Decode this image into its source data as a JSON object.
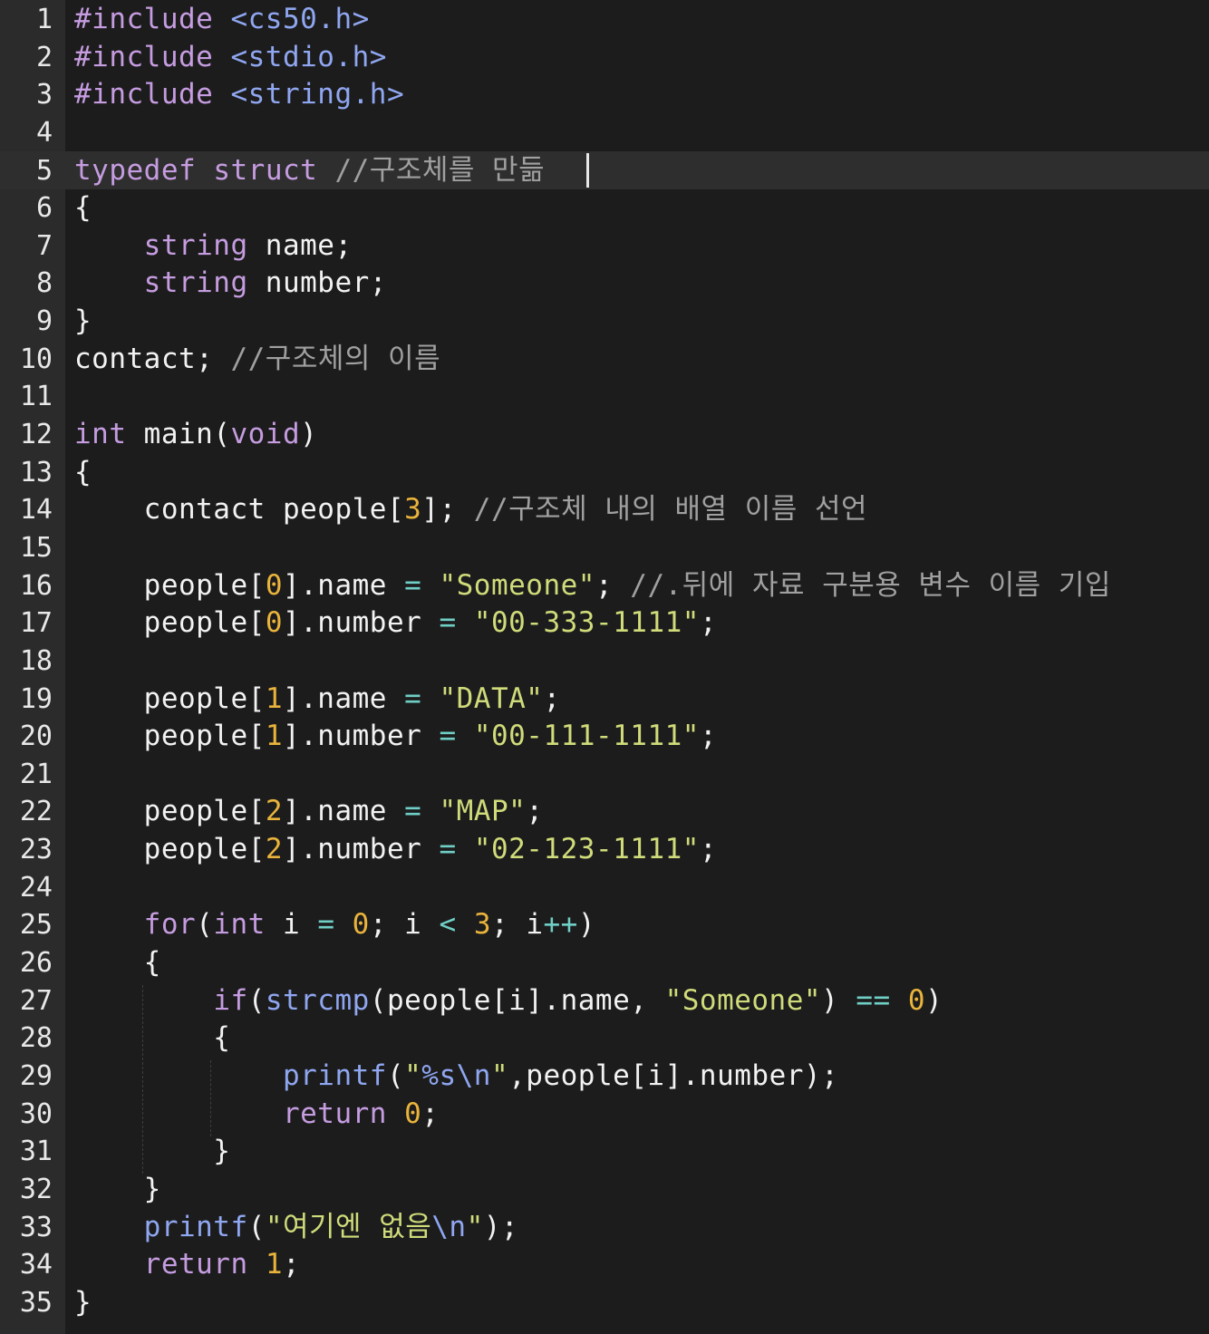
{
  "editor": {
    "active_line": 5,
    "lines": [
      {
        "n": "1",
        "tokens": [
          [
            "pre",
            "#include"
          ],
          [
            "id",
            " "
          ],
          [
            "hdr",
            "<cs50.h>"
          ]
        ]
      },
      {
        "n": "2",
        "tokens": [
          [
            "pre",
            "#include"
          ],
          [
            "id",
            " "
          ],
          [
            "hdr",
            "<stdio.h>"
          ]
        ]
      },
      {
        "n": "3",
        "tokens": [
          [
            "pre",
            "#include"
          ],
          [
            "id",
            " "
          ],
          [
            "hdr",
            "<string.h>"
          ]
        ]
      },
      {
        "n": "4",
        "tokens": []
      },
      {
        "n": "5",
        "tokens": [
          [
            "kw",
            "typedef"
          ],
          [
            "id",
            " "
          ],
          [
            "kw",
            "struct"
          ],
          [
            "id",
            " "
          ],
          [
            "cmt",
            "//구조체를 만듦"
          ]
        ]
      },
      {
        "n": "6",
        "tokens": [
          [
            "id",
            "{"
          ]
        ]
      },
      {
        "n": "7",
        "tokens": [
          [
            "id",
            "    "
          ],
          [
            "kw",
            "string"
          ],
          [
            "id",
            " name;"
          ]
        ]
      },
      {
        "n": "8",
        "tokens": [
          [
            "id",
            "    "
          ],
          [
            "kw",
            "string"
          ],
          [
            "id",
            " number;"
          ]
        ]
      },
      {
        "n": "9",
        "tokens": [
          [
            "id",
            "}"
          ]
        ]
      },
      {
        "n": "10",
        "tokens": [
          [
            "id",
            "contact; "
          ],
          [
            "cmt",
            "//구조체의 이름"
          ]
        ]
      },
      {
        "n": "11",
        "tokens": []
      },
      {
        "n": "12",
        "tokens": [
          [
            "kw",
            "int"
          ],
          [
            "id",
            " main("
          ],
          [
            "kw",
            "void"
          ],
          [
            "id",
            ")"
          ]
        ]
      },
      {
        "n": "13",
        "tokens": [
          [
            "id",
            "{"
          ]
        ]
      },
      {
        "n": "14",
        "tokens": [
          [
            "id",
            "    contact people["
          ],
          [
            "num",
            "3"
          ],
          [
            "id",
            "]; "
          ],
          [
            "cmt",
            "//구조체 내의 배열 이름 선언"
          ]
        ]
      },
      {
        "n": "15",
        "tokens": []
      },
      {
        "n": "16",
        "tokens": [
          [
            "id",
            "    people["
          ],
          [
            "num",
            "0"
          ],
          [
            "id",
            "].name "
          ],
          [
            "op",
            "="
          ],
          [
            "id",
            " "
          ],
          [
            "str",
            "\"Someone\""
          ],
          [
            "id",
            "; "
          ],
          [
            "cmt",
            "//.뒤에 자료 구분용 변수 이름 기입"
          ]
        ]
      },
      {
        "n": "17",
        "tokens": [
          [
            "id",
            "    people["
          ],
          [
            "num",
            "0"
          ],
          [
            "id",
            "].number "
          ],
          [
            "op",
            "="
          ],
          [
            "id",
            " "
          ],
          [
            "str",
            "\"00-333-1111\""
          ],
          [
            "id",
            ";"
          ]
        ]
      },
      {
        "n": "18",
        "tokens": []
      },
      {
        "n": "19",
        "tokens": [
          [
            "id",
            "    people["
          ],
          [
            "num",
            "1"
          ],
          [
            "id",
            "].name "
          ],
          [
            "op",
            "="
          ],
          [
            "id",
            " "
          ],
          [
            "str",
            "\"DATA\""
          ],
          [
            "id",
            ";"
          ]
        ]
      },
      {
        "n": "20",
        "tokens": [
          [
            "id",
            "    people["
          ],
          [
            "num",
            "1"
          ],
          [
            "id",
            "].number "
          ],
          [
            "op",
            "="
          ],
          [
            "id",
            " "
          ],
          [
            "str",
            "\"00-111-1111\""
          ],
          [
            "id",
            ";"
          ]
        ]
      },
      {
        "n": "21",
        "tokens": []
      },
      {
        "n": "22",
        "tokens": [
          [
            "id",
            "    people["
          ],
          [
            "num",
            "2"
          ],
          [
            "id",
            "].name "
          ],
          [
            "op",
            "="
          ],
          [
            "id",
            " "
          ],
          [
            "str",
            "\"MAP\""
          ],
          [
            "id",
            ";"
          ]
        ]
      },
      {
        "n": "23",
        "tokens": [
          [
            "id",
            "    people["
          ],
          [
            "num",
            "2"
          ],
          [
            "id",
            "].number "
          ],
          [
            "op",
            "="
          ],
          [
            "id",
            " "
          ],
          [
            "str",
            "\"02-123-1111\""
          ],
          [
            "id",
            ";"
          ]
        ]
      },
      {
        "n": "24",
        "tokens": []
      },
      {
        "n": "25",
        "tokens": [
          [
            "id",
            "    "
          ],
          [
            "kw",
            "for"
          ],
          [
            "id",
            "("
          ],
          [
            "kw",
            "int"
          ],
          [
            "id",
            " i "
          ],
          [
            "op",
            "="
          ],
          [
            "id",
            " "
          ],
          [
            "num",
            "0"
          ],
          [
            "id",
            "; i "
          ],
          [
            "op",
            "<"
          ],
          [
            "id",
            " "
          ],
          [
            "num",
            "3"
          ],
          [
            "id",
            "; i"
          ],
          [
            "op",
            "++"
          ],
          [
            "id",
            ")"
          ]
        ]
      },
      {
        "n": "26",
        "tokens": [
          [
            "id",
            "    {"
          ]
        ]
      },
      {
        "n": "27",
        "tokens": [
          [
            "id",
            "        "
          ],
          [
            "kw",
            "if"
          ],
          [
            "id",
            "("
          ],
          [
            "fn",
            "strcmp"
          ],
          [
            "id",
            "(people[i].name, "
          ],
          [
            "str",
            "\"Someone\""
          ],
          [
            "id",
            ") "
          ],
          [
            "op",
            "=="
          ],
          [
            "id",
            " "
          ],
          [
            "num",
            "0"
          ],
          [
            "id",
            ")"
          ]
        ]
      },
      {
        "n": "28",
        "tokens": [
          [
            "id",
            "        {"
          ]
        ]
      },
      {
        "n": "29",
        "tokens": [
          [
            "id",
            "            "
          ],
          [
            "fn",
            "printf"
          ],
          [
            "id",
            "("
          ],
          [
            "str",
            "\""
          ],
          [
            "esc",
            "%s\\n"
          ],
          [
            "str",
            "\""
          ],
          [
            "id",
            ",people[i].number);"
          ]
        ]
      },
      {
        "n": "30",
        "tokens": [
          [
            "id",
            "            "
          ],
          [
            "kw",
            "return"
          ],
          [
            "id",
            " "
          ],
          [
            "num",
            "0"
          ],
          [
            "id",
            ";"
          ]
        ]
      },
      {
        "n": "31",
        "tokens": [
          [
            "id",
            "        }"
          ]
        ]
      },
      {
        "n": "32",
        "tokens": [
          [
            "id",
            "    }"
          ]
        ]
      },
      {
        "n": "33",
        "tokens": [
          [
            "id",
            "    "
          ],
          [
            "fn",
            "printf"
          ],
          [
            "id",
            "("
          ],
          [
            "str",
            "\"여기엔 없음"
          ],
          [
            "esc",
            "\\n"
          ],
          [
            "str",
            "\""
          ],
          [
            "id",
            ");"
          ]
        ]
      },
      {
        "n": "34",
        "tokens": [
          [
            "id",
            "    "
          ],
          [
            "kw",
            "return"
          ],
          [
            "id",
            " "
          ],
          [
            "num",
            "1"
          ],
          [
            "id",
            ";"
          ]
        ]
      },
      {
        "n": "35",
        "tokens": [
          [
            "id",
            "}"
          ]
        ]
      }
    ]
  }
}
